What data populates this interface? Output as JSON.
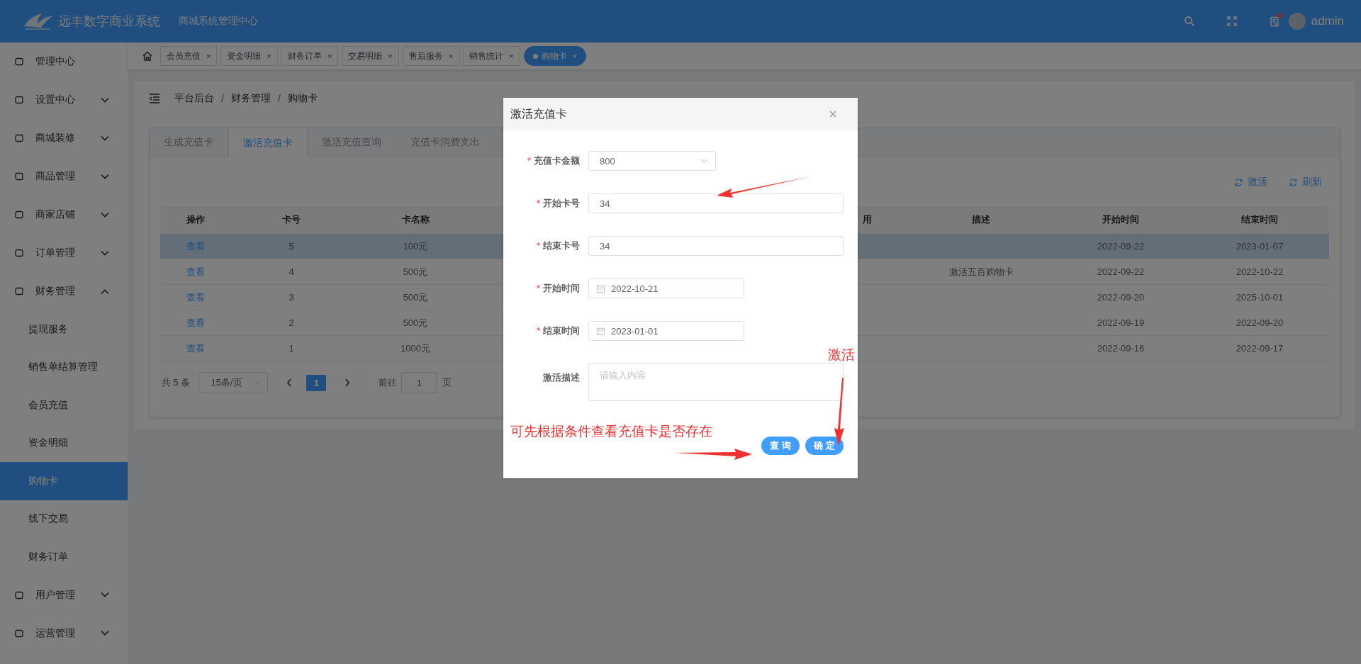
{
  "header": {
    "system_name": "远丰数字商业系统",
    "subtitle": "商城系统管理中心",
    "user": "admin",
    "notification_badge": true
  },
  "sidebar": {
    "items": [
      {
        "label": "管理中心",
        "kind": "link",
        "selected": false
      },
      {
        "label": "设置中心",
        "kind": "group",
        "expanded": false,
        "selected": false
      },
      {
        "label": "商城装修",
        "kind": "group",
        "expanded": false,
        "selected": false
      },
      {
        "label": "商品管理",
        "kind": "group",
        "expanded": false,
        "selected": false
      },
      {
        "label": "商家店铺",
        "kind": "group",
        "expanded": false,
        "selected": false
      },
      {
        "label": "订单管理",
        "kind": "group",
        "expanded": false,
        "selected": false
      },
      {
        "label": "财务管理",
        "kind": "group",
        "expanded": true,
        "selected": false,
        "children": [
          {
            "label": "提现服务",
            "selected": false
          },
          {
            "label": "销售单结算管理",
            "selected": false
          },
          {
            "label": "会员充值",
            "selected": false
          },
          {
            "label": "资金明细",
            "selected": false
          },
          {
            "label": "购物卡",
            "selected": true
          },
          {
            "label": "线下交易",
            "selected": false
          },
          {
            "label": "财务订单",
            "selected": false
          }
        ]
      },
      {
        "label": "用户管理",
        "kind": "group",
        "expanded": false,
        "selected": false
      },
      {
        "label": "运营管理",
        "kind": "group",
        "expanded": false,
        "selected": false
      }
    ]
  },
  "tags": [
    {
      "label": "会员充值",
      "close": "×",
      "selected": false
    },
    {
      "label": "资金明细",
      "close": "×",
      "selected": false
    },
    {
      "label": "财务订单",
      "close": "×",
      "selected": false
    },
    {
      "label": "交易明细",
      "close": "×",
      "selected": false
    },
    {
      "label": "售后服务",
      "close": "×",
      "selected": false
    },
    {
      "label": "销售统计",
      "close": "×",
      "selected": false
    },
    {
      "label": "购物卡",
      "close": "×",
      "selected": true
    }
  ],
  "breadcrumb": {
    "items": [
      "平台后台",
      "财务管理",
      "购物卡"
    ],
    "separators": [
      "/",
      "/"
    ]
  },
  "tabs": [
    {
      "label": "生成充值卡",
      "selected": false
    },
    {
      "label": "激活充值卡",
      "selected": true
    },
    {
      "label": "激活充值查询",
      "selected": false
    },
    {
      "label": "充值卡消费支出",
      "selected": false
    }
  ],
  "toolbar": [
    {
      "label": "激活"
    },
    {
      "label": "刷新"
    }
  ],
  "table": {
    "columns": [
      "操作",
      "卡号",
      "卡名称",
      "用",
      "描述",
      "开始时间",
      "结束时间"
    ],
    "rows": [
      {
        "action": "查看",
        "card_no": "5",
        "card_name": "100元",
        "start": "2022-09-22",
        "end": "2023-01-07",
        "hovered": true
      },
      {
        "action": "查看",
        "card_no": "4",
        "card_name": "500元",
        "description": "激活五百购物卡",
        "start": "2022-09-22",
        "end": "2022-10-22",
        "hovered": false
      },
      {
        "action": "查看",
        "card_no": "3",
        "card_name": "500元",
        "start": "2022-09-20",
        "end": "2025-10-01",
        "hovered": false
      },
      {
        "action": "查看",
        "card_no": "2",
        "card_name": "500元",
        "start": "2022-09-19",
        "end": "2022-09-20",
        "hovered": false
      },
      {
        "action": "查看",
        "card_no": "1",
        "card_name": "1000元",
        "start": "2022-09-16",
        "end": "2022-09-17",
        "hovered": false
      }
    ]
  },
  "pagination": {
    "total": "共 5 条",
    "page_size": "15条/页",
    "current": "1",
    "goto_label": "前往",
    "goto_value": "1",
    "page_suffix": "页"
  },
  "dialog": {
    "title": "激活充值卡",
    "fields": [
      {
        "label": "充值卡金额",
        "required_mark": "*",
        "kind": "select",
        "value": "800"
      },
      {
        "label": "开始卡号",
        "required_mark": "*",
        "kind": "input",
        "value": "34"
      },
      {
        "label": "结束卡号",
        "required_mark": "*",
        "kind": "input",
        "value": "34"
      },
      {
        "label": "开始时间",
        "required_mark": "*",
        "kind": "date",
        "value": "2022-10-21"
      },
      {
        "label": "结束时间",
        "required_mark": "*",
        "kind": "date",
        "value": "2023-01-01"
      },
      {
        "label": "激活描述",
        "kind": "textarea",
        "placeholder": "请输入内容"
      }
    ],
    "buttons": [
      {
        "label": "查 询"
      },
      {
        "label": "确 定"
      }
    ]
  },
  "annotations": [
    {
      "text": "激活"
    },
    {
      "text": "可先根据条件查看充值卡是否存在"
    }
  ]
}
